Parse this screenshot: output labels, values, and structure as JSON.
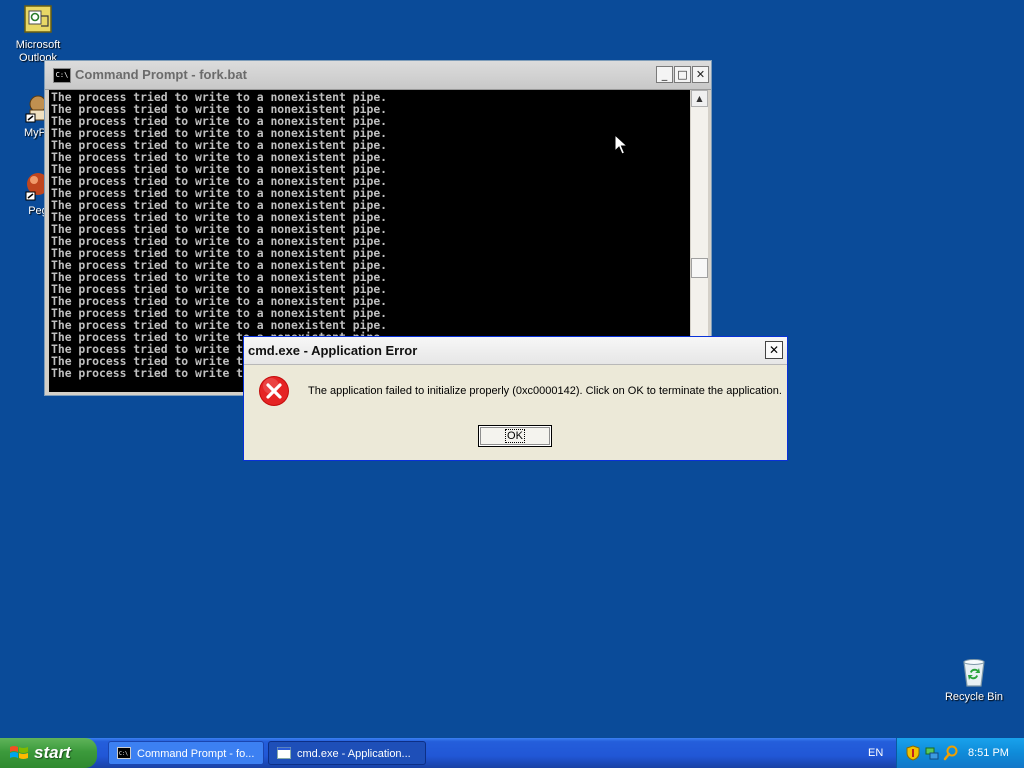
{
  "desktop": {
    "icons": [
      {
        "label": "Microsoft Outlook",
        "icon": "outlook-icon"
      },
      {
        "label": "MyPa",
        "icon": "my-pa-icon"
      },
      {
        "label": "Peg",
        "icon": "peg-icon"
      },
      {
        "label": "Recycle Bin",
        "icon": "recycle-bin-icon"
      }
    ]
  },
  "cmd_window": {
    "title": "Command Prompt - fork.bat",
    "system_icon_text": "C:\\",
    "minimize_label": "_",
    "maximize_label": "□",
    "close_label": "✕",
    "line_text": "The process tried to write to a nonexistent pipe.",
    "line_count": 24
  },
  "error_dialog": {
    "title": "cmd.exe - Application Error",
    "message": "The application failed to initialize properly (0xc0000142). Click on OK to terminate the application.",
    "ok_label": "OK",
    "close_label": "✕",
    "icon": "error-x-icon"
  },
  "taskbar": {
    "start_label": "start",
    "tasks": [
      {
        "label": "Command Prompt - fo...",
        "icon": "cmd-icon",
        "active": false
      },
      {
        "label": "cmd.exe - Application...",
        "icon": "window-icon",
        "active": true
      }
    ],
    "language": "EN",
    "tray_icons": [
      "security-shield-icon",
      "network-icon",
      "search-icon"
    ],
    "clock": "8:51 PM"
  },
  "colors": {
    "desktop": "#0a4b99",
    "taskbar": "#245edb",
    "start_button": "#3c9a3c",
    "error_icon": "#d20f0f"
  }
}
